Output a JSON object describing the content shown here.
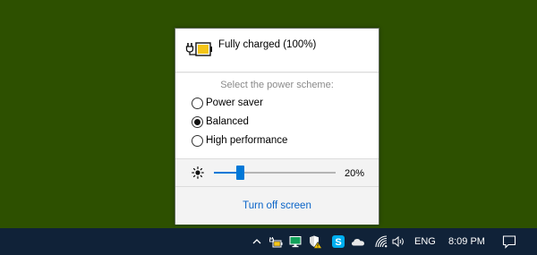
{
  "power_flyout": {
    "battery_status": "Fully charged (100%)",
    "battery_level_percent": 100,
    "battery_icon": "battery-charging-icon",
    "scheme_heading": "Select the power scheme:",
    "schemes": [
      {
        "label": "Power saver",
        "selected": false
      },
      {
        "label": "Balanced",
        "selected": true
      },
      {
        "label": "High performance",
        "selected": false
      }
    ],
    "brightness_icon": "sun-icon",
    "brightness_value": "20%",
    "brightness_level_percent": 20,
    "footer_link": "Turn off screen"
  },
  "taskbar": {
    "tray_icons": [
      "chevron-up-icon",
      "battery-icon",
      "monitor-icon",
      "defender-shield-icon",
      "skype-icon",
      "onedrive-cloud-icon",
      "wifi-icon",
      "volume-icon"
    ],
    "language": "ENG",
    "time": "8:09 PM",
    "notification_icon": "action-center-icon"
  },
  "colors": {
    "desktop_background": "#2d5000",
    "taskbar_background": "#102238",
    "accent": "#0078d7",
    "link": "#0a64c8",
    "battery_fill": "#f5c518"
  }
}
